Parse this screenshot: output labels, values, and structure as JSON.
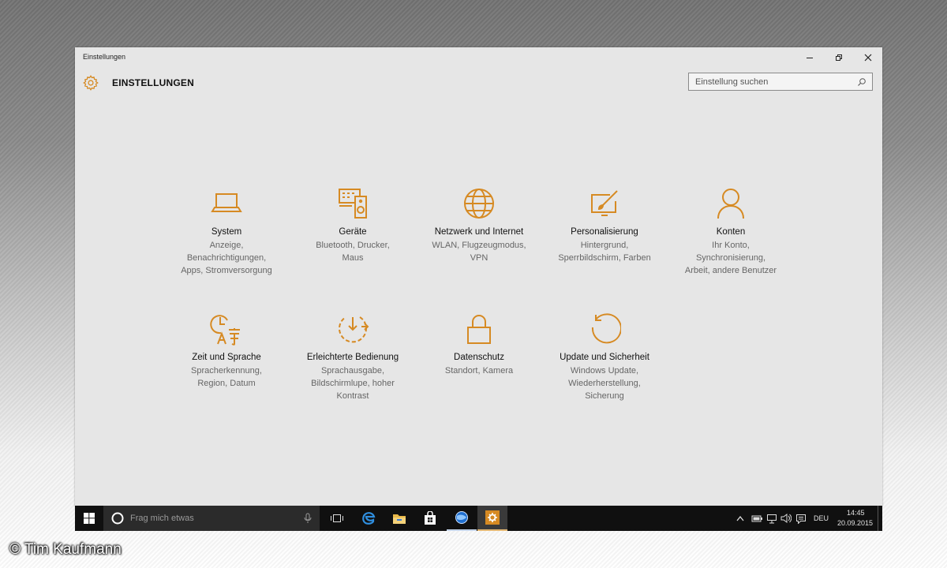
{
  "window": {
    "title": "Einstellungen"
  },
  "header": {
    "title": "EINSTELLUNGEN"
  },
  "search": {
    "placeholder": "Einstellung suchen"
  },
  "accent_color": "#d68a23",
  "tiles": [
    {
      "icon": "laptop-icon",
      "title": "System",
      "subtitle": [
        "Anzeige,",
        "Benachrichtigungen,",
        "Apps, Stromversorgung"
      ]
    },
    {
      "icon": "devices-icon",
      "title": "Geräte",
      "subtitle": [
        "Bluetooth, Drucker,",
        "Maus"
      ]
    },
    {
      "icon": "globe-icon",
      "title": "Netzwerk und Internet",
      "subtitle": [
        "WLAN, Flugzeugmodus,",
        "VPN"
      ]
    },
    {
      "icon": "personalization-icon",
      "title": "Personalisierung",
      "subtitle": [
        "Hintergrund,",
        "Sperrbildschirm, Farben"
      ]
    },
    {
      "icon": "person-icon",
      "title": "Konten",
      "subtitle": [
        "Ihr Konto,",
        "Synchronisierung,",
        "Arbeit, andere Benutzer"
      ]
    },
    {
      "icon": "time-language-icon",
      "title": "Zeit und Sprache",
      "subtitle": [
        "Spracherkennung,",
        "Region, Datum"
      ]
    },
    {
      "icon": "ease-of-access-icon",
      "title": "Erleichterte Bedienung",
      "subtitle": [
        "Sprachausgabe,",
        "Bildschirmlupe, hoher",
        "Kontrast"
      ]
    },
    {
      "icon": "lock-icon",
      "title": "Datenschutz",
      "subtitle": [
        "Standort, Kamera"
      ]
    },
    {
      "icon": "update-icon",
      "title": "Update und Sicherheit",
      "subtitle": [
        "Windows Update,",
        "Wiederherstellung,",
        "Sicherung"
      ]
    }
  ],
  "taskbar": {
    "search_text": "Frag mich etwas",
    "language": "DEU",
    "time": "14:45",
    "date": "20.09.2015"
  },
  "credit": "© Tim Kaufmann"
}
